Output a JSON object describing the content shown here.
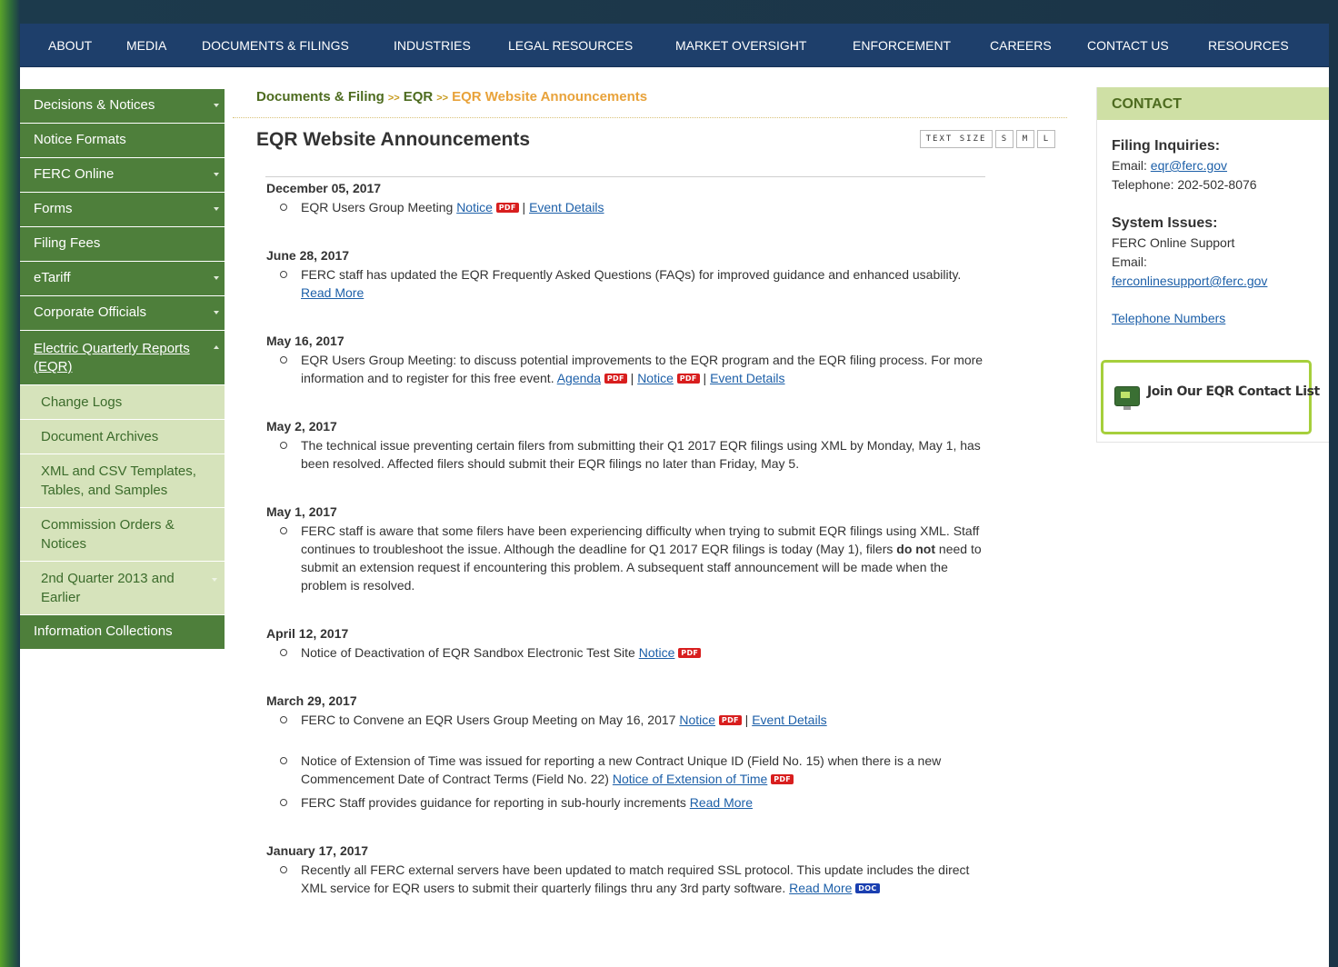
{
  "top_nav": [
    "ABOUT",
    "MEDIA",
    "DOCUMENTS & FILINGS",
    "INDUSTRIES",
    "LEGAL RESOURCES",
    "MARKET OVERSIGHT",
    "ENFORCEMENT",
    "CAREERS",
    "CONTACT US",
    "RESOURCES"
  ],
  "sidebar": {
    "items": [
      {
        "label": "Decisions & Notices",
        "caret": "chevron-down-icon"
      },
      {
        "label": "Notice Formats"
      },
      {
        "label": "FERC Online",
        "caret": "chevron-down-icon"
      },
      {
        "label": "Forms",
        "caret": "chevron-down-icon"
      },
      {
        "label": "Filing Fees"
      },
      {
        "label": "eTariff",
        "caret": "chevron-down-icon"
      },
      {
        "label": "Corporate Officials",
        "caret": "chevron-down-icon"
      },
      {
        "label": "Electric Quarterly Reports (EQR)",
        "caret": "chevron-up-icon",
        "active": true
      }
    ],
    "sub_items": [
      "Change Logs",
      "Document Archives",
      "XML and CSV Templates, Tables, and Samples",
      "Commission Orders & Notices",
      "2nd Quarter 2013 and Earlier"
    ],
    "last_item": "Information Collections"
  },
  "breadcrumb": {
    "items": [
      "Documents & Filing",
      "EQR"
    ],
    "current": "EQR Website Announcements",
    "separator": ">>"
  },
  "page_title": "EQR Website Announcements",
  "text_size": {
    "label": "TEXT SIZE",
    "options": [
      "S",
      "M",
      "L"
    ]
  },
  "announcements": {
    "e1": {
      "date": "December 05, 2017",
      "text": "EQR Users Group Meeting",
      "link1": "Notice",
      "pdf": "PDF",
      "sep": "|",
      "link2": "Event Details"
    },
    "e2": {
      "date": "June 28, 2017",
      "text": "FERC staff has updated the EQR Frequently Asked Questions (FAQs) for improved guidance and enhanced usability.",
      "link": "Read More"
    },
    "e3": {
      "date": "May 16, 2017",
      "text": "EQR Users Group Meeting: to discuss potential improvements to the EQR program and the EQR filing process. For more information and to register for this free event.",
      "link1": "Agenda",
      "pdf": "PDF",
      "sep": "|",
      "link2": "Notice",
      "link3": "Event Details"
    },
    "e4": {
      "date": "May 2, 2017",
      "text": "The technical issue preventing certain filers from submitting their Q1 2017 EQR filings using XML by Monday, May 1, has been resolved. Affected filers should submit their EQR filings no later than Friday, May 5."
    },
    "e5": {
      "date": "May 1, 2017",
      "text_a": "FERC staff is aware that some filers have been experiencing difficulty when trying to submit EQR filings using XML. Staff continues to troubleshoot the issue. Although the deadline for Q1 2017 EQR filings is today (May 1), filers",
      "bold": "do not",
      "text_b": "need to submit an extension request if encountering this problem. A subsequent staff announcement will be made when the problem is resolved."
    },
    "e6": {
      "date": "April 12, 2017",
      "text": "Notice of Deactivation of EQR Sandbox Electronic Test Site",
      "link": "Notice",
      "pdf": "PDF"
    },
    "e7": {
      "date": "March 29, 2017",
      "text": "FERC to Convene an EQR Users Group Meeting on May 16, 2017",
      "link1": "Notice",
      "pdf": "PDF",
      "sep": "|",
      "link2": "Event Details"
    },
    "e7b": {
      "text": "Notice of Extension of Time was issued for reporting a new Contract Unique ID (Field No. 15) when there is a new Commencement Date of Contract Terms (Field No. 22)",
      "link": "Notice of Extension of Time",
      "pdf": "PDF"
    },
    "e7c": {
      "text": "FERC Staff provides guidance for reporting in sub-hourly increments",
      "link": "Read More"
    },
    "e8": {
      "date": "January 17, 2017",
      "text": "Recently all FERC external servers have been updated to match required SSL protocol. This update includes the direct XML service for EQR users to submit their quarterly filings thru any 3rd party software.",
      "link": "Read More",
      "doc": "DOC"
    }
  },
  "contact": {
    "heading": "CONTACT",
    "filing_title": "Filing Inquiries:",
    "email_label": "Email:",
    "email": "eqr@ferc.gov",
    "telephone": "Telephone: 202-502-8076",
    "system_title": "System Issues:",
    "support": "FERC Online Support",
    "support_email_label": "Email:",
    "support_email": "ferconlinesupport@ferc.gov",
    "phone_link": "Telephone Numbers",
    "join_label": "Join Our EQR Contact List"
  },
  "colors": {
    "nav_bg": "#1e3f6b",
    "sidebar_green": "#4e7f3b",
    "sub_green": "#d6e3bb",
    "link": "#1c5fa8",
    "accent_orange": "#e8a23a",
    "join_border": "#a6cf3c"
  }
}
